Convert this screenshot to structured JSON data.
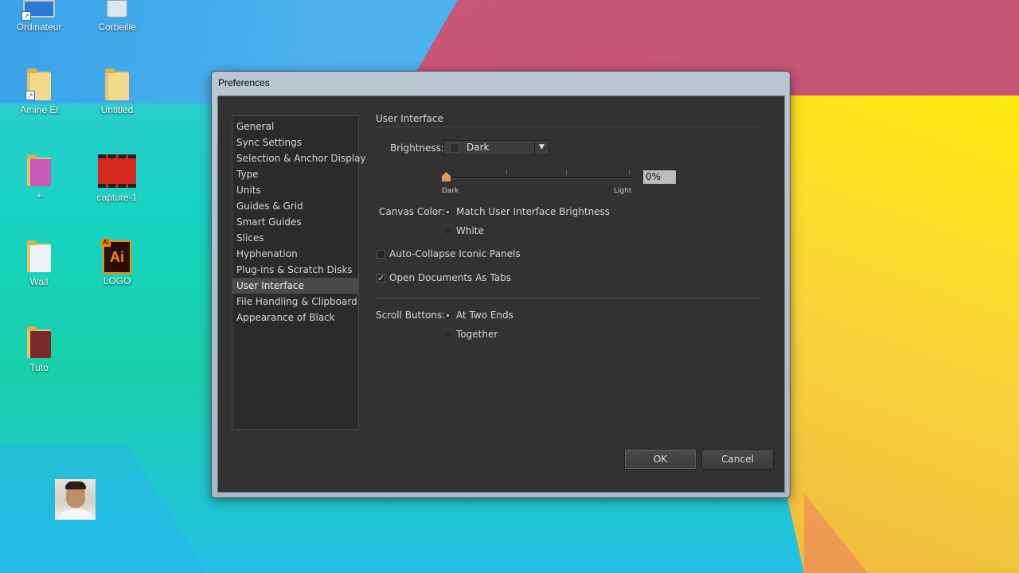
{
  "desktop": {
    "icons": [
      {
        "label": "Ordinateur"
      },
      {
        "label": "Corbeille"
      },
      {
        "label": "Amine El"
      },
      {
        "label": "Untitled"
      },
      {
        "label": "+"
      },
      {
        "label": "capture-1"
      },
      {
        "label": "Wall"
      },
      {
        "label": "LOGO"
      },
      {
        "label": "Tuto"
      }
    ],
    "ai_badge": "Ai"
  },
  "dialog": {
    "title": "Preferences",
    "categories": [
      "General",
      "Sync Settings",
      "Selection & Anchor Display",
      "Type",
      "Units",
      "Guides & Grid",
      "Smart Guides",
      "Slices",
      "Hyphenation",
      "Plug-ins & Scratch Disks",
      "User Interface",
      "File Handling & Clipboard",
      "Appearance of Black"
    ],
    "selected_category": "User Interface",
    "section_title": "User Interface",
    "brightness": {
      "label": "Brightness:",
      "value": "Dark",
      "slider_percent": "0%",
      "slider_value": 0,
      "min_label": "Dark",
      "max_label": "Light"
    },
    "canvas_color": {
      "label": "Canvas Color:",
      "options": [
        "Match User Interface Brightness",
        "White"
      ],
      "selected": "Match User Interface Brightness"
    },
    "auto_collapse": {
      "label": "Auto-Collapse Iconic Panels",
      "checked": false
    },
    "open_as_tabs": {
      "label": "Open Documents As Tabs",
      "checked": true
    },
    "scroll_buttons": {
      "label": "Scroll Buttons:",
      "options": [
        "At Two Ends",
        "Together"
      ],
      "selected": "At Two Ends"
    },
    "buttons": {
      "ok": "OK",
      "cancel": "Cancel"
    }
  },
  "colors": {
    "dialog_bg": "#323232",
    "text": "#d6d6d6",
    "selected_item": "#4a4a4a",
    "slider_thumb": "#d7a35b"
  },
  "icon_names": {
    "check": "✓"
  }
}
